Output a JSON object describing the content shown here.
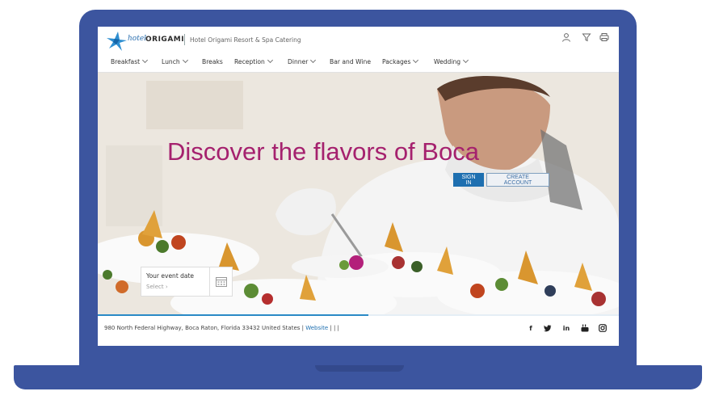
{
  "brand": {
    "hotel_word": "hotel",
    "origami_word": "ORIGAMI",
    "tagline": "Hotel Origami Resort & Spa  Catering"
  },
  "nav": {
    "items": [
      {
        "label": "Breakfast",
        "dropdown": true
      },
      {
        "label": "Lunch",
        "dropdown": true
      },
      {
        "label": "Breaks",
        "dropdown": false
      },
      {
        "label": "Reception",
        "dropdown": true
      },
      {
        "label": "Dinner",
        "dropdown": true
      },
      {
        "label": "Bar and Wine",
        "dropdown": false
      },
      {
        "label": "Packages",
        "dropdown": true
      },
      {
        "label": "Wedding",
        "dropdown": true
      }
    ]
  },
  "header_icons": [
    "user-icon",
    "filter-icon",
    "print-icon"
  ],
  "hero": {
    "title": "Discover the flavors of Boca",
    "signin_label": "SIGN IN",
    "create_label": "CREATE ACCOUNT",
    "event_label": "Your event date",
    "event_select": "Select ›"
  },
  "progress_fraction": 0.52,
  "footer": {
    "address": "980 North Federal Highway, Boca Raton, Florida 33432 United States |",
    "website_label": "Website",
    "trailing": "| | |",
    "social": [
      "facebook-icon",
      "twitter-icon",
      "linkedin-icon",
      "youtube-icon",
      "instagram-icon"
    ]
  },
  "colors": {
    "frame": "#3c559f",
    "title": "#a5216e",
    "primary": "#1e6fb0"
  }
}
